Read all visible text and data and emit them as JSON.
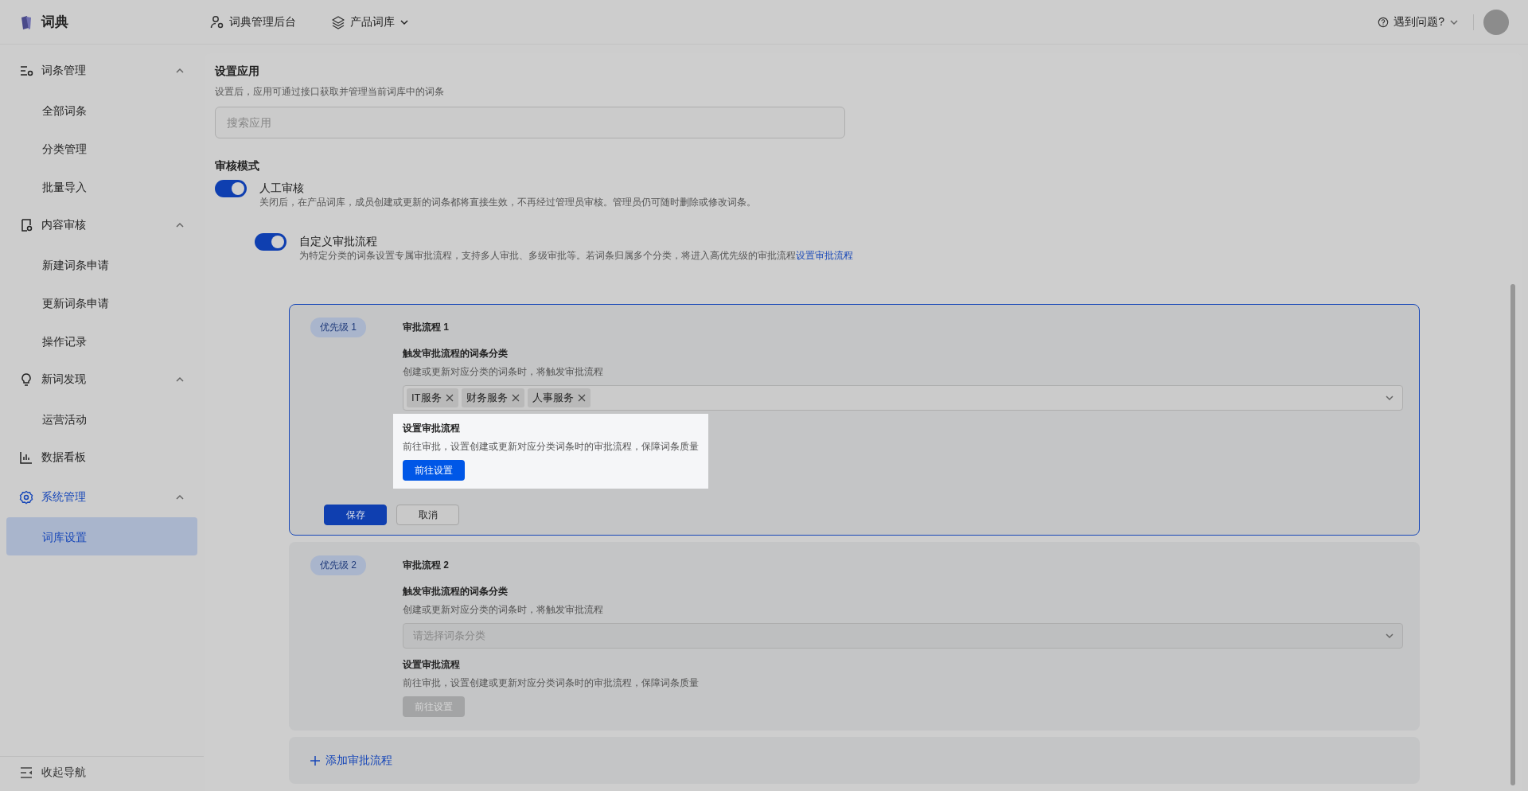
{
  "topbar": {
    "brand": "词典",
    "nav": [
      {
        "label": "词典管理后台",
        "kind": "admin"
      },
      {
        "label": "产品词库",
        "kind": "library"
      }
    ],
    "help": "遇到问题?"
  },
  "sidebar": {
    "groups": [
      {
        "label": "词条管理",
        "kind": "entries",
        "active": false,
        "expanded": true,
        "items": [
          {
            "label": "全部词条",
            "selected": false
          },
          {
            "label": "分类管理",
            "selected": false
          },
          {
            "label": "批量导入",
            "selected": false
          }
        ]
      },
      {
        "label": "内容审核",
        "kind": "review",
        "active": false,
        "expanded": true,
        "items": [
          {
            "label": "新建词条申请",
            "selected": false
          },
          {
            "label": "更新词条申请",
            "selected": false
          },
          {
            "label": "操作记录",
            "selected": false
          }
        ]
      },
      {
        "label": "新词发现",
        "kind": "discover",
        "active": false,
        "expanded": true,
        "items": [
          {
            "label": "运营活动",
            "selected": false
          }
        ]
      },
      {
        "label": "数据看板",
        "kind": "dashboard",
        "active": false
      },
      {
        "label": "系统管理",
        "kind": "system",
        "active": true,
        "expanded": true,
        "items": [
          {
            "label": "词库设置",
            "selected": true
          }
        ]
      }
    ],
    "collapse": "收起导航"
  },
  "app_setting": {
    "title": "设置应用",
    "description": "设置后，应用可通过接口获取并管理当前词库中的词条",
    "search": {
      "placeholder": "搜索应用"
    }
  },
  "review": {
    "title": "审核模式",
    "manual": {
      "label": "人工审核",
      "on": true,
      "description": "关闭后，在产品词库，成员创建或更新的词条都将直接生效，不再经过管理员审核。管理员仍可随时删除或修改词条。"
    },
    "custom": {
      "label": "自定义审批流程",
      "on": true,
      "description": "为特定分类的词条设置专属审批流程，支持多人审批、多级审批等。若词条归属多个分类，将进入高优先级的审批流程",
      "link": "设置审批流程"
    }
  },
  "flows": [
    {
      "priority": "优先级 1",
      "title": "审批流程 1",
      "editing": true,
      "trigger": {
        "label": "触发审批流程的词条分类",
        "description": "创建或更新对应分类的词条时，将触发审批流程",
        "tags": [
          "IT服务",
          "财务服务",
          "人事服务"
        ],
        "disabled": false
      },
      "setup": {
        "label": "设置审批流程",
        "description": "前往审批，设置创建或更新对应分类词条时的审批流程，保障词条质量",
        "button": "前往设置",
        "disabled": false,
        "highlighted": true
      },
      "actions": [
        "保存",
        "取消"
      ]
    },
    {
      "priority": "优先级 2",
      "title": "审批流程 2",
      "editing": false,
      "trigger": {
        "label": "触发审批流程的词条分类",
        "description": "创建或更新对应分类的词条时，将触发审批流程",
        "placeholder": "请选择词条分类",
        "disabled": true
      },
      "setup": {
        "label": "设置审批流程",
        "description": "前往审批，设置创建或更新对应分类词条时的审批流程，保障词条质量",
        "button": "前往设置",
        "disabled": true,
        "highlighted": false
      }
    }
  ],
  "add_flow": "添加审批流程"
}
